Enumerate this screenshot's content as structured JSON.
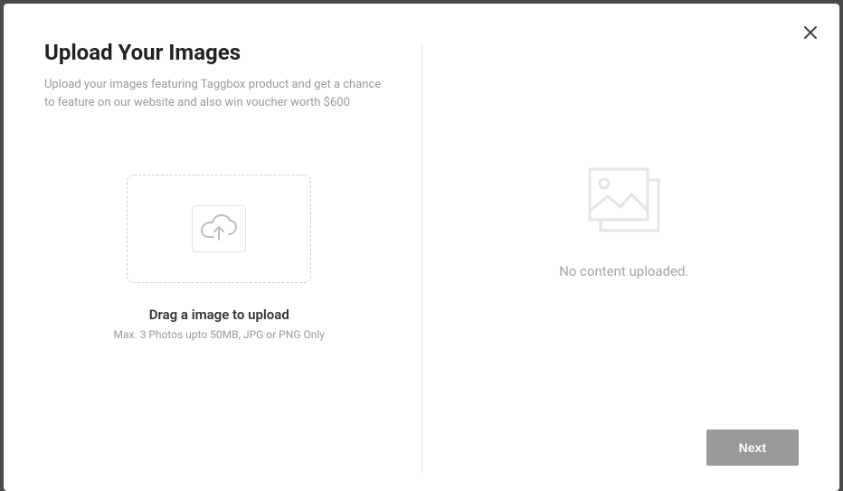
{
  "modal": {
    "title": "Upload Your Images",
    "subtitle": "Upload your images featuring Taggbox product and get a chance to feature on our website and also win voucher worth $600"
  },
  "dropzone": {
    "drag_label": "Drag a image to upload",
    "constraints": "Max. 3 Photos upto 50MB, JPG or PNG Only"
  },
  "preview": {
    "empty_label": "No content uploaded."
  },
  "actions": {
    "next_label": "Next"
  }
}
